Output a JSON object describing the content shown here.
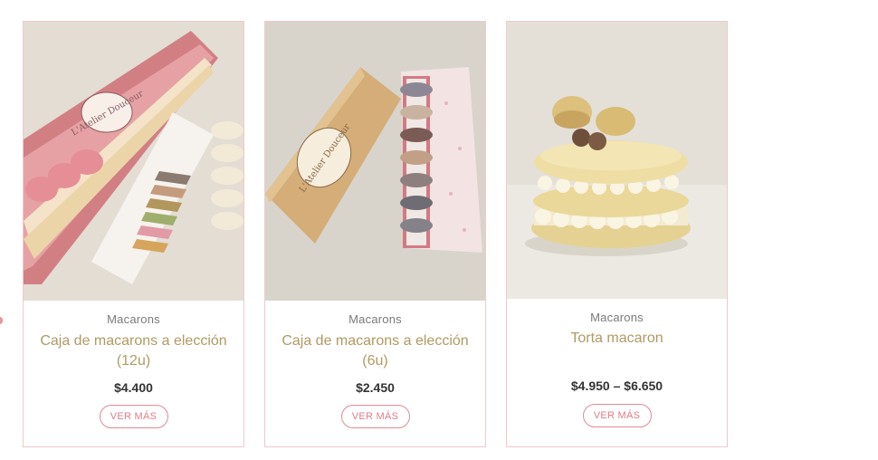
{
  "products": [
    {
      "category": "Macarons",
      "title": "Caja de macarons a elección (12u)",
      "price": "$4.400",
      "button": "VER MÁS",
      "image_alt": "Caja rosa de 12 macarons"
    },
    {
      "category": "Macarons",
      "title": "Caja de macarons a elección (6u)",
      "price": "$2.450",
      "button": "VER MÁS",
      "image_alt": "Caja dorada de 6 macarons"
    },
    {
      "category": "Macarons",
      "title": "Torta macaron",
      "price": "$4.950 – $6.650",
      "button": "VER MÁS",
      "image_alt": "Torta macaron con crema"
    }
  ],
  "box_brand": "L'Atelier Douceur",
  "colors": {
    "accent_pink": "#e07c87",
    "title_gold": "#b09a63",
    "card_border": "#f2c9cc"
  }
}
